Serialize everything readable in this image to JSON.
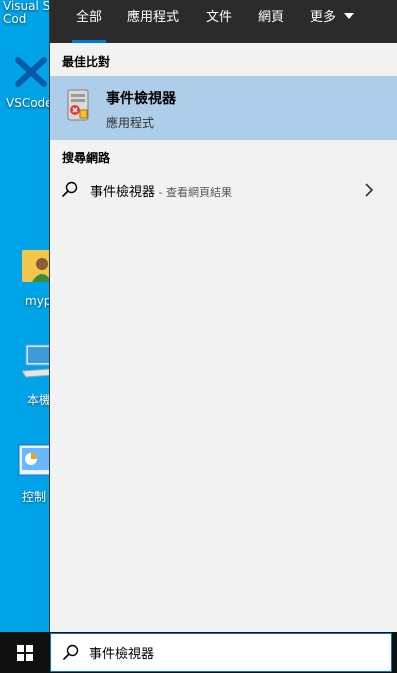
{
  "desktop": {
    "icons": [
      {
        "label": "Visual St\nCod"
      },
      {
        "label": "VSCode"
      },
      {
        "label": "myp"
      },
      {
        "label": "本機"
      },
      {
        "label": "控制"
      }
    ]
  },
  "tabs": [
    {
      "label": "全部",
      "active": true
    },
    {
      "label": "應用程式"
    },
    {
      "label": "文件"
    },
    {
      "label": "網頁"
    },
    {
      "label": "更多"
    }
  ],
  "best_match": {
    "heading": "最佳比對",
    "title": "事件檢視器",
    "subtitle": "應用程式"
  },
  "web_search": {
    "heading": "搜尋網路",
    "query": "事件檢視器",
    "suffix": " - 查看網頁結果"
  },
  "taskbar": {
    "search_value": "事件檢視器"
  },
  "colors": {
    "accent": "#0078d7",
    "desktop_bg": "#00a3e8",
    "selected_row": "#aecde8"
  }
}
